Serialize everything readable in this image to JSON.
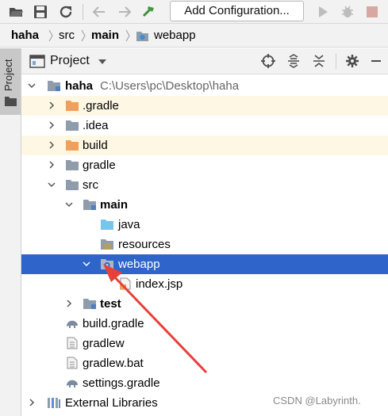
{
  "toolbar": {
    "add_configuration_label": "Add Configuration...",
    "icons": [
      "open-folder-icon",
      "save-icon",
      "sync-icon",
      "back-arrow-icon",
      "forward-arrow-icon",
      "build-hammer-icon",
      "run-icon",
      "debug-icon",
      "stop-icon"
    ]
  },
  "breadcrumb": [
    "haha",
    "src",
    "main",
    "webapp"
  ],
  "stripe": {
    "label": "Project"
  },
  "project_panel": {
    "title": "Project",
    "header_icons": [
      "locate-icon",
      "expand-all-icon",
      "collapse-all-icon",
      "settings-icon",
      "hide-icon"
    ]
  },
  "tree": {
    "root": {
      "name": "haha",
      "path": "C:\\Users\\pc\\Desktop\\haha"
    },
    "items": [
      {
        "label": ".gradle",
        "type": "folder-excluded",
        "expanded": false
      },
      {
        "label": ".idea",
        "type": "folder",
        "expanded": false
      },
      {
        "label": "build",
        "type": "folder-excluded",
        "expanded": false
      },
      {
        "label": "gradle",
        "type": "folder",
        "expanded": false
      },
      {
        "label": "src",
        "type": "folder",
        "expanded": true
      },
      {
        "label": "main",
        "type": "module-folder",
        "expanded": true
      },
      {
        "label": "java",
        "type": "source-folder"
      },
      {
        "label": "resources",
        "type": "resources-folder"
      },
      {
        "label": "webapp",
        "type": "web-folder",
        "expanded": true,
        "selected": true
      },
      {
        "label": "index.jsp",
        "type": "jsp-file"
      },
      {
        "label": "test",
        "type": "module-folder",
        "expanded": false
      },
      {
        "label": "build.gradle",
        "type": "gradle-file"
      },
      {
        "label": "gradlew",
        "type": "file"
      },
      {
        "label": "gradlew.bat",
        "type": "file"
      },
      {
        "label": "settings.gradle",
        "type": "gradle-file"
      },
      {
        "label": "External Libraries",
        "type": "libraries",
        "expanded": false
      }
    ]
  },
  "watermark": "CSDN @Labyrinth.",
  "colors": {
    "selection": "#2f65ca",
    "excluded_bg": "#fdf7e4",
    "excluded_folder": "#f0a05a",
    "folder": "#8f9cab",
    "source_folder": "#77c4ec",
    "annotation_arrow": "#e8403a"
  }
}
